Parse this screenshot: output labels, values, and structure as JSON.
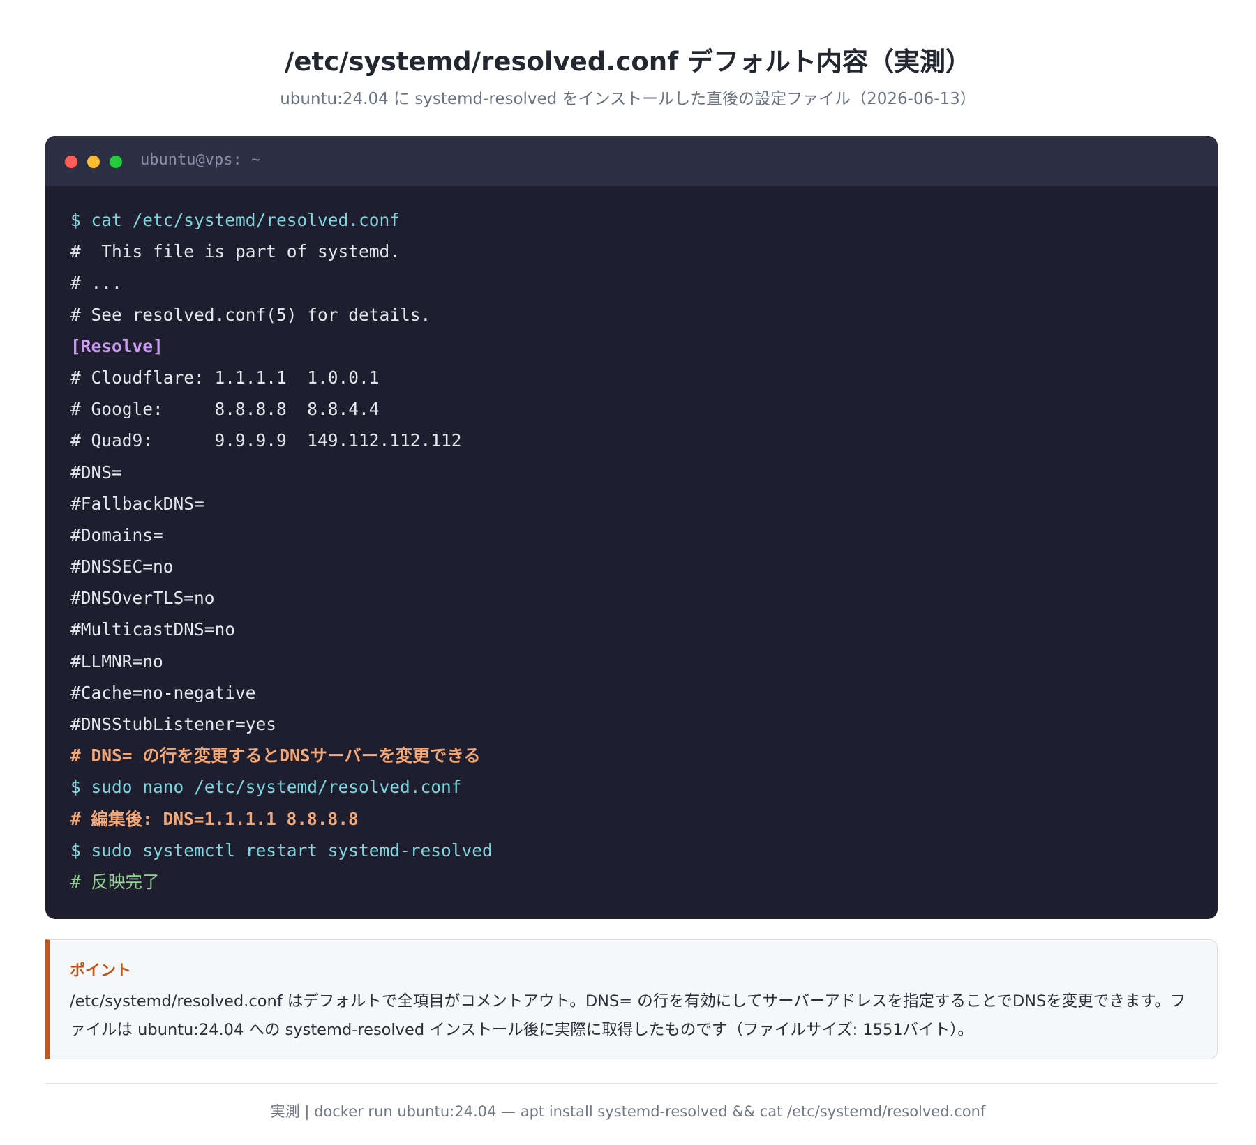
{
  "header": {
    "title": "/etc/systemd/resolved.conf デフォルト内容（実測）",
    "subtitle": "ubuntu:24.04 に systemd-resolved をインストールした直後の設定ファイル（2026-06-13）"
  },
  "terminal": {
    "title": "ubuntu@vps: ~",
    "lines": [
      {
        "kind": "cmd",
        "text": "$ cat /etc/systemd/resolved.conf"
      },
      {
        "kind": "comment",
        "text": "#  This file is part of systemd."
      },
      {
        "kind": "comment",
        "text": "# ..."
      },
      {
        "kind": "comment",
        "text": "# See resolved.conf(5) for details."
      },
      {
        "kind": "section",
        "text": "[Resolve]"
      },
      {
        "kind": "comment",
        "text": "# Cloudflare: 1.1.1.1  1.0.0.1"
      },
      {
        "kind": "comment",
        "text": "# Google:     8.8.8.8  8.8.4.4"
      },
      {
        "kind": "comment",
        "text": "# Quad9:      9.9.9.9  149.112.112.112"
      },
      {
        "kind": "plain",
        "text": "#DNS="
      },
      {
        "kind": "plain",
        "text": "#FallbackDNS="
      },
      {
        "kind": "plain",
        "text": "#Domains="
      },
      {
        "kind": "plain",
        "text": "#DNSSEC=no"
      },
      {
        "kind": "plain",
        "text": "#DNSOverTLS=no"
      },
      {
        "kind": "plain",
        "text": "#MulticastDNS=no"
      },
      {
        "kind": "plain",
        "text": "#LLMNR=no"
      },
      {
        "kind": "plain",
        "text": "#Cache=no-negative"
      },
      {
        "kind": "plain",
        "text": "#DNSStubListener=yes"
      },
      {
        "kind": "highlight",
        "text": "# DNS= の行を変更するとDNSサーバーを変更できる"
      },
      {
        "kind": "cmd",
        "text": "$ sudo nano /etc/systemd/resolved.conf"
      },
      {
        "kind": "highlight",
        "text": "# 編集後: DNS=1.1.1.1 8.8.8.8"
      },
      {
        "kind": "cmd",
        "text": "$ sudo systemctl restart systemd-resolved"
      },
      {
        "kind": "done",
        "text": "# 反映完了"
      }
    ]
  },
  "note": {
    "title": "ポイント",
    "text": "/etc/systemd/resolved.conf はデフォルトで全項目がコメントアウト。DNS= の行を有効にしてサーバーアドレスを指定することでDNSを変更できます。ファイルは ubuntu:24.04 への systemd-resolved インストール後に実際に取得したものです（ファイルサイズ: 1551バイト）。"
  },
  "footer": {
    "text": "実測 | docker run ubuntu:24.04 — apt install systemd-resolved && cat /etc/systemd/resolved.conf"
  }
}
